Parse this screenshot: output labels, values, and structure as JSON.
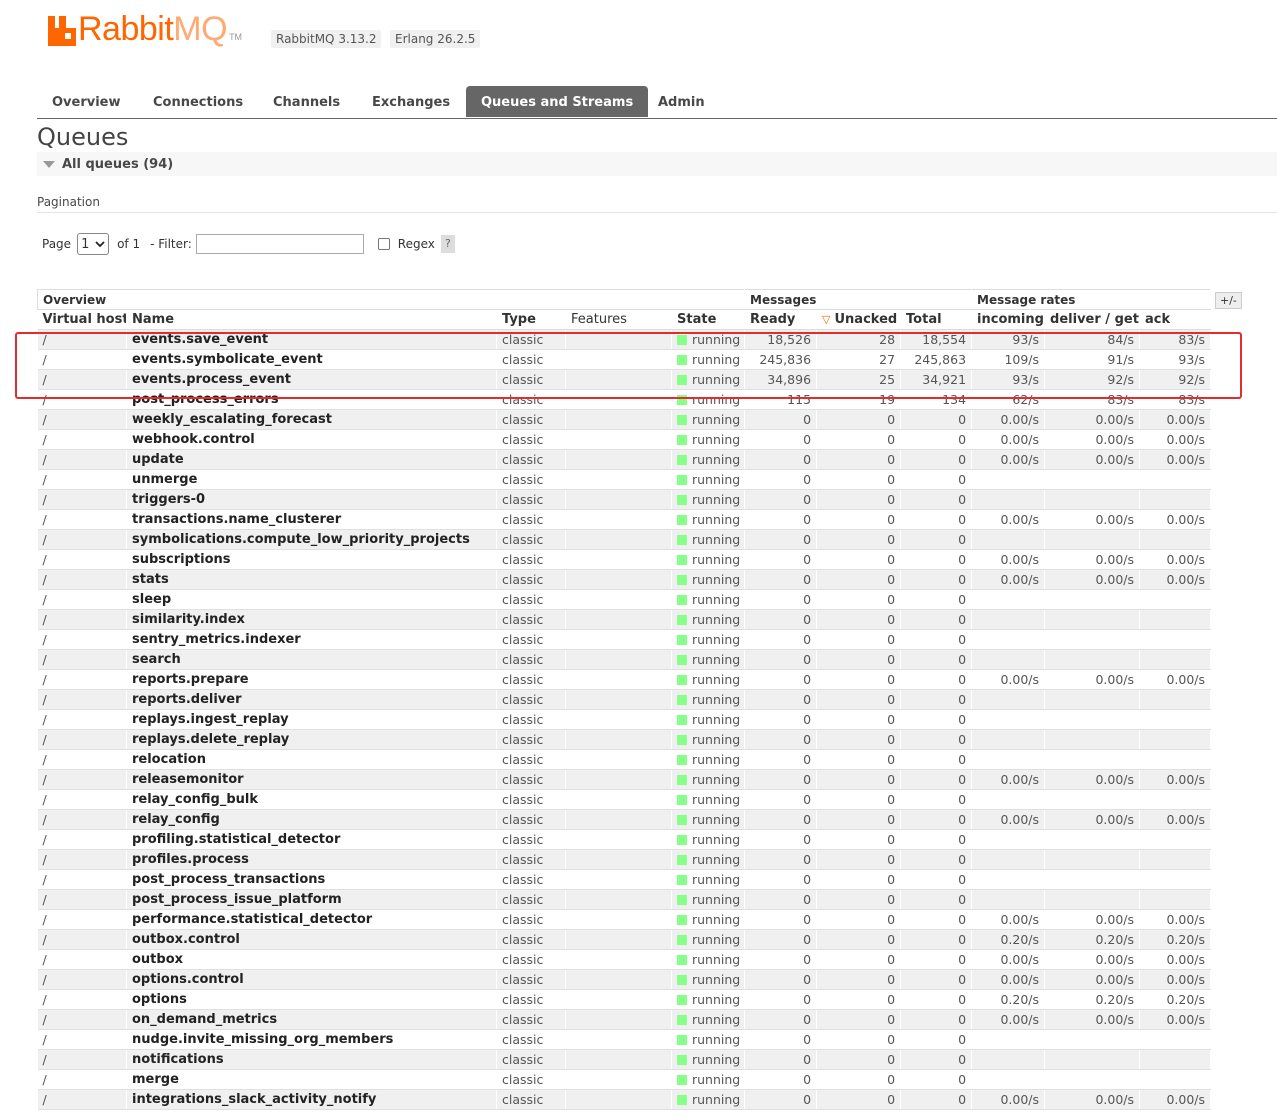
{
  "header": {
    "logo_text_rabbit": "Rabbit",
    "logo_text_mq": "MQ",
    "logo_tm": "TM",
    "rabbitmq_version": "RabbitMQ 3.13.2",
    "erlang_version": "Erlang 26.2.5",
    "brand_color": "#ff6600"
  },
  "tabs": [
    "Overview",
    "Connections",
    "Channels",
    "Exchanges",
    "Queues and Streams",
    "Admin"
  ],
  "active_tab": "Queues and Streams",
  "page_title": "Queues",
  "section_title": "All queues (94)",
  "pagination": {
    "label": "Pagination",
    "page_label": "Page",
    "page_value": "1",
    "of_label": "of 1",
    "filter_label": "- Filter:",
    "filter_value": "",
    "regex_label": "Regex",
    "help": "?"
  },
  "table": {
    "group_headers": {
      "overview": "Overview",
      "messages": "Messages",
      "rates": "Message rates"
    },
    "columns": [
      "Virtual host",
      "Name",
      "Type",
      "Features",
      "State",
      "Ready",
      "Unacked",
      "Total",
      "incoming",
      "deliver / get",
      "ack"
    ],
    "sort_indicator": "▽",
    "toggle_columns": "+/-",
    "rows": [
      {
        "vhost": "/",
        "name": "events.save_event",
        "type": "classic",
        "features": "",
        "state": "running",
        "ready": "18,526",
        "unacked": "28",
        "total": "18,554",
        "incoming": "93/s",
        "deliver": "84/s",
        "ack": "83/s"
      },
      {
        "vhost": "/",
        "name": "events.symbolicate_event",
        "type": "classic",
        "features": "",
        "state": "running",
        "ready": "245,836",
        "unacked": "27",
        "total": "245,863",
        "incoming": "109/s",
        "deliver": "91/s",
        "ack": "93/s"
      },
      {
        "vhost": "/",
        "name": "events.process_event",
        "type": "classic",
        "features": "",
        "state": "running",
        "ready": "34,896",
        "unacked": "25",
        "total": "34,921",
        "incoming": "93/s",
        "deliver": "92/s",
        "ack": "92/s"
      },
      {
        "vhost": "/",
        "name": "post_process_errors",
        "type": "classic",
        "features": "",
        "state": "running",
        "ready": "115",
        "unacked": "19",
        "total": "134",
        "incoming": "62/s",
        "deliver": "83/s",
        "ack": "83/s"
      },
      {
        "vhost": "/",
        "name": "weekly_escalating_forecast",
        "type": "classic",
        "features": "",
        "state": "running",
        "ready": "0",
        "unacked": "0",
        "total": "0",
        "incoming": "0.00/s",
        "deliver": "0.00/s",
        "ack": "0.00/s"
      },
      {
        "vhost": "/",
        "name": "webhook.control",
        "type": "classic",
        "features": "",
        "state": "running",
        "ready": "0",
        "unacked": "0",
        "total": "0",
        "incoming": "0.00/s",
        "deliver": "0.00/s",
        "ack": "0.00/s"
      },
      {
        "vhost": "/",
        "name": "update",
        "type": "classic",
        "features": "",
        "state": "running",
        "ready": "0",
        "unacked": "0",
        "total": "0",
        "incoming": "0.00/s",
        "deliver": "0.00/s",
        "ack": "0.00/s"
      },
      {
        "vhost": "/",
        "name": "unmerge",
        "type": "classic",
        "features": "",
        "state": "running",
        "ready": "0",
        "unacked": "0",
        "total": "0",
        "incoming": "",
        "deliver": "",
        "ack": ""
      },
      {
        "vhost": "/",
        "name": "triggers-0",
        "type": "classic",
        "features": "",
        "state": "running",
        "ready": "0",
        "unacked": "0",
        "total": "0",
        "incoming": "",
        "deliver": "",
        "ack": ""
      },
      {
        "vhost": "/",
        "name": "transactions.name_clusterer",
        "type": "classic",
        "features": "",
        "state": "running",
        "ready": "0",
        "unacked": "0",
        "total": "0",
        "incoming": "0.00/s",
        "deliver": "0.00/s",
        "ack": "0.00/s"
      },
      {
        "vhost": "/",
        "name": "symbolications.compute_low_priority_projects",
        "type": "classic",
        "features": "",
        "state": "running",
        "ready": "0",
        "unacked": "0",
        "total": "0",
        "incoming": "",
        "deliver": "",
        "ack": ""
      },
      {
        "vhost": "/",
        "name": "subscriptions",
        "type": "classic",
        "features": "",
        "state": "running",
        "ready": "0",
        "unacked": "0",
        "total": "0",
        "incoming": "0.00/s",
        "deliver": "0.00/s",
        "ack": "0.00/s"
      },
      {
        "vhost": "/",
        "name": "stats",
        "type": "classic",
        "features": "",
        "state": "running",
        "ready": "0",
        "unacked": "0",
        "total": "0",
        "incoming": "0.00/s",
        "deliver": "0.00/s",
        "ack": "0.00/s"
      },
      {
        "vhost": "/",
        "name": "sleep",
        "type": "classic",
        "features": "",
        "state": "running",
        "ready": "0",
        "unacked": "0",
        "total": "0",
        "incoming": "",
        "deliver": "",
        "ack": ""
      },
      {
        "vhost": "/",
        "name": "similarity.index",
        "type": "classic",
        "features": "",
        "state": "running",
        "ready": "0",
        "unacked": "0",
        "total": "0",
        "incoming": "",
        "deliver": "",
        "ack": ""
      },
      {
        "vhost": "/",
        "name": "sentry_metrics.indexer",
        "type": "classic",
        "features": "",
        "state": "running",
        "ready": "0",
        "unacked": "0",
        "total": "0",
        "incoming": "",
        "deliver": "",
        "ack": ""
      },
      {
        "vhost": "/",
        "name": "search",
        "type": "classic",
        "features": "",
        "state": "running",
        "ready": "0",
        "unacked": "0",
        "total": "0",
        "incoming": "",
        "deliver": "",
        "ack": ""
      },
      {
        "vhost": "/",
        "name": "reports.prepare",
        "type": "classic",
        "features": "",
        "state": "running",
        "ready": "0",
        "unacked": "0",
        "total": "0",
        "incoming": "0.00/s",
        "deliver": "0.00/s",
        "ack": "0.00/s"
      },
      {
        "vhost": "/",
        "name": "reports.deliver",
        "type": "classic",
        "features": "",
        "state": "running",
        "ready": "0",
        "unacked": "0",
        "total": "0",
        "incoming": "",
        "deliver": "",
        "ack": ""
      },
      {
        "vhost": "/",
        "name": "replays.ingest_replay",
        "type": "classic",
        "features": "",
        "state": "running",
        "ready": "0",
        "unacked": "0",
        "total": "0",
        "incoming": "",
        "deliver": "",
        "ack": ""
      },
      {
        "vhost": "/",
        "name": "replays.delete_replay",
        "type": "classic",
        "features": "",
        "state": "running",
        "ready": "0",
        "unacked": "0",
        "total": "0",
        "incoming": "",
        "deliver": "",
        "ack": ""
      },
      {
        "vhost": "/",
        "name": "relocation",
        "type": "classic",
        "features": "",
        "state": "running",
        "ready": "0",
        "unacked": "0",
        "total": "0",
        "incoming": "",
        "deliver": "",
        "ack": ""
      },
      {
        "vhost": "/",
        "name": "releasemonitor",
        "type": "classic",
        "features": "",
        "state": "running",
        "ready": "0",
        "unacked": "0",
        "total": "0",
        "incoming": "0.00/s",
        "deliver": "0.00/s",
        "ack": "0.00/s"
      },
      {
        "vhost": "/",
        "name": "relay_config_bulk",
        "type": "classic",
        "features": "",
        "state": "running",
        "ready": "0",
        "unacked": "0",
        "total": "0",
        "incoming": "",
        "deliver": "",
        "ack": ""
      },
      {
        "vhost": "/",
        "name": "relay_config",
        "type": "classic",
        "features": "",
        "state": "running",
        "ready": "0",
        "unacked": "0",
        "total": "0",
        "incoming": "0.00/s",
        "deliver": "0.00/s",
        "ack": "0.00/s"
      },
      {
        "vhost": "/",
        "name": "profiling.statistical_detector",
        "type": "classic",
        "features": "",
        "state": "running",
        "ready": "0",
        "unacked": "0",
        "total": "0",
        "incoming": "",
        "deliver": "",
        "ack": ""
      },
      {
        "vhost": "/",
        "name": "profiles.process",
        "type": "classic",
        "features": "",
        "state": "running",
        "ready": "0",
        "unacked": "0",
        "total": "0",
        "incoming": "",
        "deliver": "",
        "ack": ""
      },
      {
        "vhost": "/",
        "name": "post_process_transactions",
        "type": "classic",
        "features": "",
        "state": "running",
        "ready": "0",
        "unacked": "0",
        "total": "0",
        "incoming": "",
        "deliver": "",
        "ack": ""
      },
      {
        "vhost": "/",
        "name": "post_process_issue_platform",
        "type": "classic",
        "features": "",
        "state": "running",
        "ready": "0",
        "unacked": "0",
        "total": "0",
        "incoming": "",
        "deliver": "",
        "ack": ""
      },
      {
        "vhost": "/",
        "name": "performance.statistical_detector",
        "type": "classic",
        "features": "",
        "state": "running",
        "ready": "0",
        "unacked": "0",
        "total": "0",
        "incoming": "0.00/s",
        "deliver": "0.00/s",
        "ack": "0.00/s"
      },
      {
        "vhost": "/",
        "name": "outbox.control",
        "type": "classic",
        "features": "",
        "state": "running",
        "ready": "0",
        "unacked": "0",
        "total": "0",
        "incoming": "0.20/s",
        "deliver": "0.20/s",
        "ack": "0.20/s"
      },
      {
        "vhost": "/",
        "name": "outbox",
        "type": "classic",
        "features": "",
        "state": "running",
        "ready": "0",
        "unacked": "0",
        "total": "0",
        "incoming": "0.00/s",
        "deliver": "0.00/s",
        "ack": "0.00/s"
      },
      {
        "vhost": "/",
        "name": "options.control",
        "type": "classic",
        "features": "",
        "state": "running",
        "ready": "0",
        "unacked": "0",
        "total": "0",
        "incoming": "0.00/s",
        "deliver": "0.00/s",
        "ack": "0.00/s"
      },
      {
        "vhost": "/",
        "name": "options",
        "type": "classic",
        "features": "",
        "state": "running",
        "ready": "0",
        "unacked": "0",
        "total": "0",
        "incoming": "0.20/s",
        "deliver": "0.20/s",
        "ack": "0.20/s"
      },
      {
        "vhost": "/",
        "name": "on_demand_metrics",
        "type": "classic",
        "features": "",
        "state": "running",
        "ready": "0",
        "unacked": "0",
        "total": "0",
        "incoming": "0.00/s",
        "deliver": "0.00/s",
        "ack": "0.00/s"
      },
      {
        "vhost": "/",
        "name": "nudge.invite_missing_org_members",
        "type": "classic",
        "features": "",
        "state": "running",
        "ready": "0",
        "unacked": "0",
        "total": "0",
        "incoming": "",
        "deliver": "",
        "ack": ""
      },
      {
        "vhost": "/",
        "name": "notifications",
        "type": "classic",
        "features": "",
        "state": "running",
        "ready": "0",
        "unacked": "0",
        "total": "0",
        "incoming": "",
        "deliver": "",
        "ack": ""
      },
      {
        "vhost": "/",
        "name": "merge",
        "type": "classic",
        "features": "",
        "state": "running",
        "ready": "0",
        "unacked": "0",
        "total": "0",
        "incoming": "",
        "deliver": "",
        "ack": ""
      },
      {
        "vhost": "/",
        "name": "integrations_slack_activity_notify",
        "type": "classic",
        "features": "",
        "state": "running",
        "ready": "0",
        "unacked": "0",
        "total": "0",
        "incoming": "0.00/s",
        "deliver": "0.00/s",
        "ack": "0.00/s"
      }
    ]
  },
  "colors": {
    "running": "#88ff88",
    "highlight": "#e42c2c",
    "active_tab": "#666666"
  }
}
